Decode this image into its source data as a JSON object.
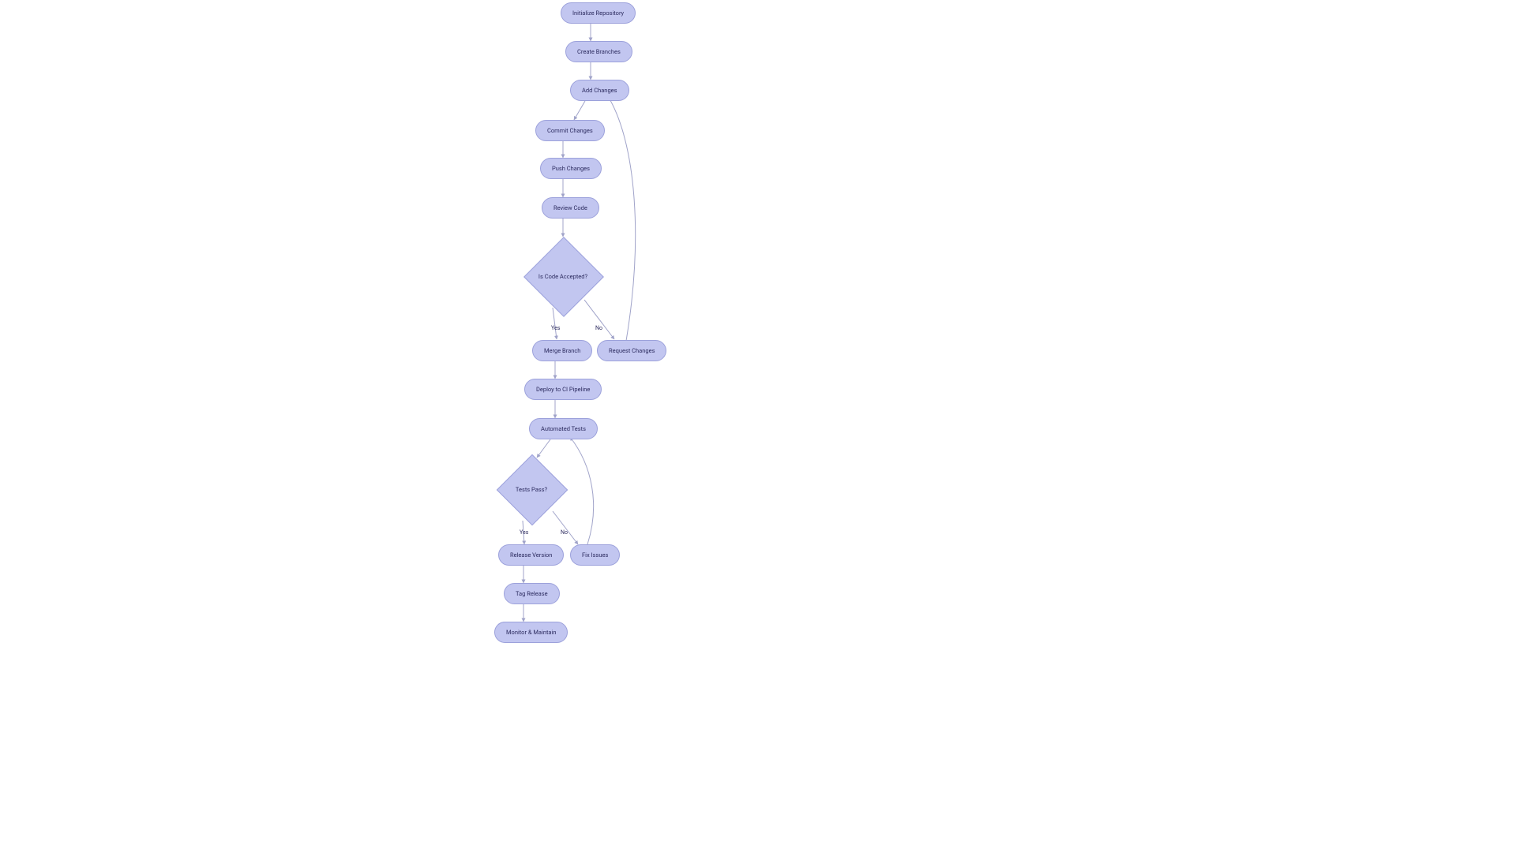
{
  "flowchart": {
    "nodes": {
      "init": {
        "label": "Initialize Repository",
        "type": "pill"
      },
      "branches": {
        "label": "Create Branches",
        "type": "pill"
      },
      "addchanges": {
        "label": "Add Changes",
        "type": "pill"
      },
      "commit": {
        "label": "Commit Changes",
        "type": "pill"
      },
      "push": {
        "label": "Push Changes",
        "type": "pill"
      },
      "review": {
        "label": "Review Code",
        "type": "pill"
      },
      "accepted": {
        "label": "Is Code Accepted?",
        "type": "decision"
      },
      "merge": {
        "label": "Merge Branch",
        "type": "pill"
      },
      "request": {
        "label": "Request Changes",
        "type": "pill"
      },
      "deploy": {
        "label": "Deploy to CI Pipeline",
        "type": "pill"
      },
      "tests": {
        "label": "Automated Tests",
        "type": "pill"
      },
      "testspass": {
        "label": "Tests Pass?",
        "type": "decision"
      },
      "release": {
        "label": "Release Version",
        "type": "pill"
      },
      "fix": {
        "label": "Fix Issues",
        "type": "pill"
      },
      "tag": {
        "label": "Tag Release",
        "type": "pill"
      },
      "monitor": {
        "label": "Monitor & Maintain",
        "type": "pill"
      }
    },
    "edges": [
      {
        "from": "init",
        "to": "branches"
      },
      {
        "from": "branches",
        "to": "addchanges"
      },
      {
        "from": "addchanges",
        "to": "commit"
      },
      {
        "from": "commit",
        "to": "push"
      },
      {
        "from": "push",
        "to": "review"
      },
      {
        "from": "review",
        "to": "accepted"
      },
      {
        "from": "accepted",
        "to": "merge",
        "label": "Yes"
      },
      {
        "from": "accepted",
        "to": "request",
        "label": "No"
      },
      {
        "from": "request",
        "to": "addchanges"
      },
      {
        "from": "merge",
        "to": "deploy"
      },
      {
        "from": "deploy",
        "to": "tests"
      },
      {
        "from": "tests",
        "to": "testspass"
      },
      {
        "from": "testspass",
        "to": "release",
        "label": "Yes"
      },
      {
        "from": "testspass",
        "to": "fix",
        "label": "No"
      },
      {
        "from": "fix",
        "to": "tests"
      },
      {
        "from": "release",
        "to": "tag"
      },
      {
        "from": "tag",
        "to": "monitor"
      }
    ],
    "edge_labels": {
      "accepted_yes": "Yes",
      "accepted_no": "No",
      "tests_yes": "Yes",
      "tests_no": "No"
    },
    "colors": {
      "node_fill": "#c2c6f0",
      "node_stroke": "#9ca1db",
      "edge_stroke": "#a0a3c9",
      "text": "#2b2a5e"
    }
  }
}
